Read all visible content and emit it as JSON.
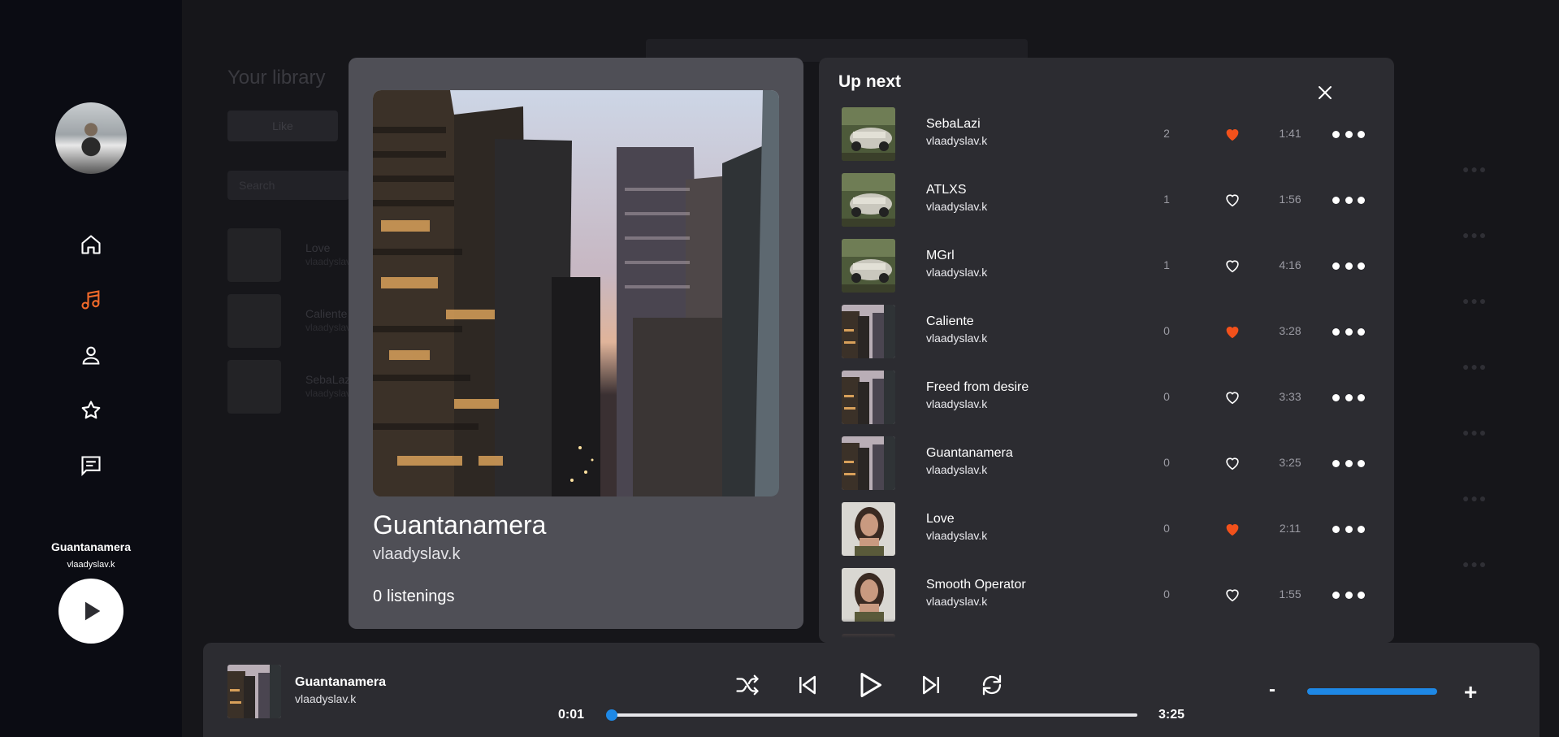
{
  "sidebar": {
    "nav_items": [
      "home-icon",
      "music-note-icon",
      "profile-icon",
      "star-icon",
      "messages-icon"
    ],
    "active_color": "#f26a2a",
    "now_playing": {
      "title": "Guantanamera",
      "artist": "vlaadyslav.k"
    }
  },
  "library": {
    "heading": "Your library",
    "tab": "Like",
    "search_placeholder": "Search",
    "items": [
      {
        "name": "Love",
        "artist": "vlaadyslav.k"
      },
      {
        "name": "Caliente",
        "artist": "vlaadyslav.k"
      },
      {
        "name": "SebaLazi",
        "artist": "vlaadyslav.k"
      }
    ]
  },
  "now_playing_card": {
    "title": "Guantanamera",
    "artist": "vlaadyslav.k",
    "listen_count": "0",
    "listen_label": "listenings"
  },
  "up_next": {
    "title": "Up next",
    "accent_color": "#f2511b",
    "tracks": [
      {
        "name": "SebaLazi",
        "artist": "vlaadyslav.k",
        "count": "2",
        "liked": true,
        "duration": "1:41",
        "art": "car"
      },
      {
        "name": "ATLXS",
        "artist": "vlaadyslav.k",
        "count": "1",
        "liked": false,
        "duration": "1:56",
        "art": "car"
      },
      {
        "name": "MGrl",
        "artist": "vlaadyslav.k",
        "count": "1",
        "liked": false,
        "duration": "4:16",
        "art": "car"
      },
      {
        "name": "Caliente",
        "artist": "vlaadyslav.k",
        "count": "0",
        "liked": true,
        "duration": "3:28",
        "art": "city"
      },
      {
        "name": "Freed from desire",
        "artist": "vlaadyslav.k",
        "count": "0",
        "liked": false,
        "duration": "3:33",
        "art": "city"
      },
      {
        "name": "Guantanamera",
        "artist": "vlaadyslav.k",
        "count": "0",
        "liked": false,
        "duration": "3:25",
        "art": "city"
      },
      {
        "name": "Love",
        "artist": "vlaadyslav.k",
        "count": "0",
        "liked": true,
        "duration": "2:11",
        "art": "portrait"
      },
      {
        "name": "Smooth Operator",
        "artist": "vlaadyslav.k",
        "count": "0",
        "liked": false,
        "duration": "1:55",
        "art": "portrait"
      }
    ]
  },
  "player": {
    "title": "Guantanamera",
    "artist": "vlaadyslav.k",
    "current_time": "0:01",
    "total_time": "3:25",
    "progress_fraction": 0.005,
    "volume_fraction": 1.0,
    "volume_minus": "-",
    "volume_plus": "+",
    "accent_color": "#1e88e5"
  }
}
